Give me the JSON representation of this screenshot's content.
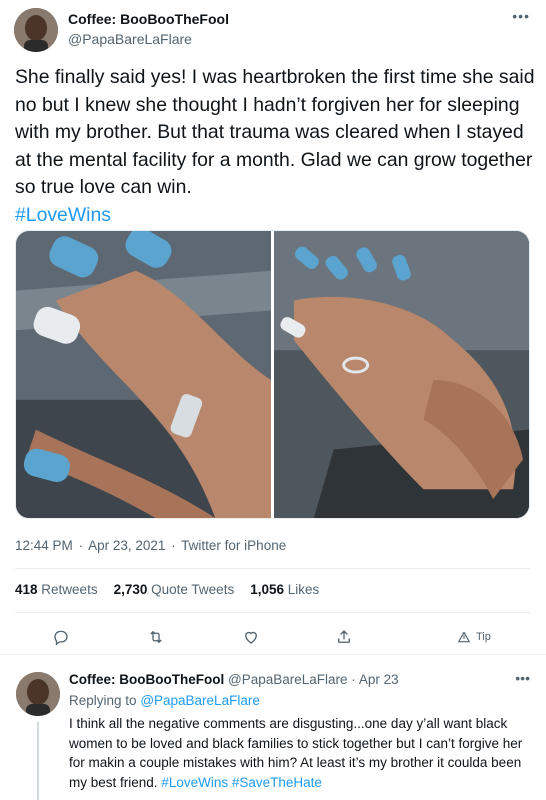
{
  "colors": {
    "accent": "#1d9bf0",
    "secondary_text": "#536471",
    "divider": "#e6ecf0"
  },
  "tweet": {
    "display_name": "Coffee: BooBooTheFool",
    "handle": "@PapaBareLaFlare",
    "more_icon": "ellipsis-icon",
    "text": "She finally said yes! I was heartbroken the first time she said no but I knew she thought I hadn’t forgiven her for sleeping with my brother. But that trauma was cleared when I stayed at the mental facility for a month. Glad we can grow together so true love can win.",
    "hashtag": "#LoveWins",
    "time": "12:44 PM",
    "date": "Apr 23, 2021",
    "source": "Twitter for iPhone",
    "separator": "·",
    "retweets_count": "418",
    "retweets_label": "Retweets",
    "quotes_count": "2,730",
    "quotes_label": "Quote Tweets",
    "likes_count": "1,056",
    "likes_label": "Likes",
    "actions": {
      "reply_icon": "comment-icon",
      "retweet_icon": "retweet-icon",
      "like_icon": "heart-icon",
      "share_icon": "share-icon",
      "tip_icon": "tip-icon",
      "tip_label": "Tip"
    }
  },
  "reply": {
    "display_name": "Coffee: BooBooTheFool",
    "handle": "@PapaBareLaFlare",
    "separator": "·",
    "date": "Apr 23",
    "replying_prefix": "Replying to",
    "replying_to": "@PapaBareLaFlare",
    "text": "I think all the negative comments are disgusting...one day y’all want black women to be loved and black families to stick together but I can’t forgive her for makin a couple mistakes with him? At least it’s my brother it coulda been my best friend.",
    "hashtag_1": "#LoveWins",
    "hashtag_2": "#SaveTheHate"
  }
}
